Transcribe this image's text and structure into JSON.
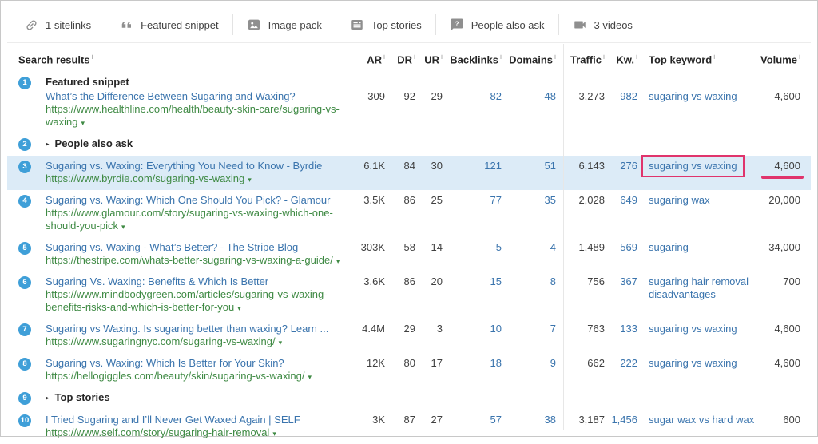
{
  "glyphs": {
    "expander": "▸",
    "caret": "▾"
  },
  "colors": {
    "accent_pink": "#e0346c",
    "link_blue": "#3a74ad",
    "url_green": "#3f8a44",
    "row_highlight": "#dcebf7",
    "circle_blue": "#3f9fd8"
  },
  "toolbar": {
    "items": [
      {
        "icon": "link-icon",
        "label": "1 sitelinks"
      },
      {
        "icon": "quote-icon",
        "label": "Featured snippet"
      },
      {
        "icon": "image-icon",
        "label": "Image pack"
      },
      {
        "icon": "news-icon",
        "label": "Top stories"
      },
      {
        "icon": "question-bubble-icon",
        "label": "People also ask"
      },
      {
        "icon": "video-icon",
        "label": "3 videos"
      }
    ]
  },
  "table": {
    "info_glyph": "i",
    "headers": {
      "results": "Search results",
      "ar": "AR",
      "dr": "DR",
      "ur": "UR",
      "backlinks": "Backlinks",
      "domains": "Domains",
      "traffic": "Traffic",
      "kw": "Kw.",
      "top_keyword": "Top keyword",
      "volume": "Volume"
    },
    "rows": [
      {
        "num": "1",
        "section": "Featured snippet",
        "expandable": false,
        "title": "What’s the Difference Between Sugaring and Waxing?",
        "url": "https://www.healthline.com/health/beauty-skin-care/sugaring-vs-waxing",
        "ar": "309",
        "dr": "92",
        "ur": "29",
        "backlinks": "82",
        "domains": "48",
        "traffic": "3,273",
        "kw": "982",
        "keyword": "sugaring vs waxing",
        "volume": "4,600"
      },
      {
        "num": "2",
        "section": "People also ask",
        "expandable": true
      },
      {
        "num": "3",
        "title": "Sugaring vs. Waxing: Everything You Need to Know - Byrdie",
        "url": "https://www.byrdie.com/sugaring-vs-waxing",
        "ar": "6.1K",
        "dr": "84",
        "ur": "30",
        "backlinks": "121",
        "domains": "51",
        "traffic": "6,143",
        "kw": "276",
        "keyword": "sugaring vs waxing",
        "volume": "4,600",
        "highlight": true,
        "keyword_boxed": true,
        "volume_underlined": true
      },
      {
        "num": "4",
        "title": "Sugaring vs. Waxing: Which One Should You Pick? - Glamour",
        "url": "https://www.glamour.com/story/sugaring-vs-waxing-which-one-should-you-pick",
        "ar": "3.5K",
        "dr": "86",
        "ur": "25",
        "backlinks": "77",
        "domains": "35",
        "traffic": "2,028",
        "kw": "649",
        "keyword": "sugaring wax",
        "volume": "20,000"
      },
      {
        "num": "5",
        "title": "Sugaring vs. Waxing - What’s Better? - The Stripe Blog",
        "url": "https://thestripe.com/whats-better-sugaring-vs-waxing-a-guide/",
        "ar": "303K",
        "dr": "58",
        "ur": "14",
        "backlinks": "5",
        "domains": "4",
        "traffic": "1,489",
        "kw": "569",
        "keyword": "sugaring",
        "volume": "34,000"
      },
      {
        "num": "6",
        "title": "Sugaring Vs. Waxing: Benefits & Which Is Better",
        "url": "https://www.mindbodygreen.com/articles/sugaring-vs-waxing-benefits-risks-and-which-is-better-for-you",
        "ar": "3.6K",
        "dr": "86",
        "ur": "20",
        "backlinks": "15",
        "domains": "8",
        "traffic": "756",
        "kw": "367",
        "keyword": "sugaring hair removal disadvantages",
        "volume": "700"
      },
      {
        "num": "7",
        "title": "Sugaring vs Waxing. Is sugaring better than waxing? Learn ...",
        "url": "https://www.sugaringnyc.com/sugaring-vs-waxing/",
        "ar": "4.4M",
        "dr": "29",
        "ur": "3",
        "backlinks": "10",
        "domains": "7",
        "traffic": "763",
        "kw": "133",
        "keyword": "sugaring vs waxing",
        "volume": "4,600"
      },
      {
        "num": "8",
        "title": "Sugaring vs. Waxing: Which Is Better for Your Skin?",
        "url": "https://hellogiggles.com/beauty/skin/sugaring-vs-waxing/",
        "ar": "12K",
        "dr": "80",
        "ur": "17",
        "backlinks": "18",
        "domains": "9",
        "traffic": "662",
        "kw": "222",
        "keyword": "sugaring vs waxing",
        "volume": "4,600"
      },
      {
        "num": "9",
        "section": "Top stories",
        "expandable": true
      },
      {
        "num": "10",
        "title": "I Tried Sugaring and I’ll Never Get Waxed Again | SELF",
        "url": "https://www.self.com/story/sugaring-hair-removal",
        "ar": "3K",
        "dr": "87",
        "ur": "27",
        "backlinks": "57",
        "domains": "38",
        "traffic": "3,187",
        "kw": "1,456",
        "keyword": "sugar wax vs hard wax",
        "volume": "600"
      }
    ]
  }
}
